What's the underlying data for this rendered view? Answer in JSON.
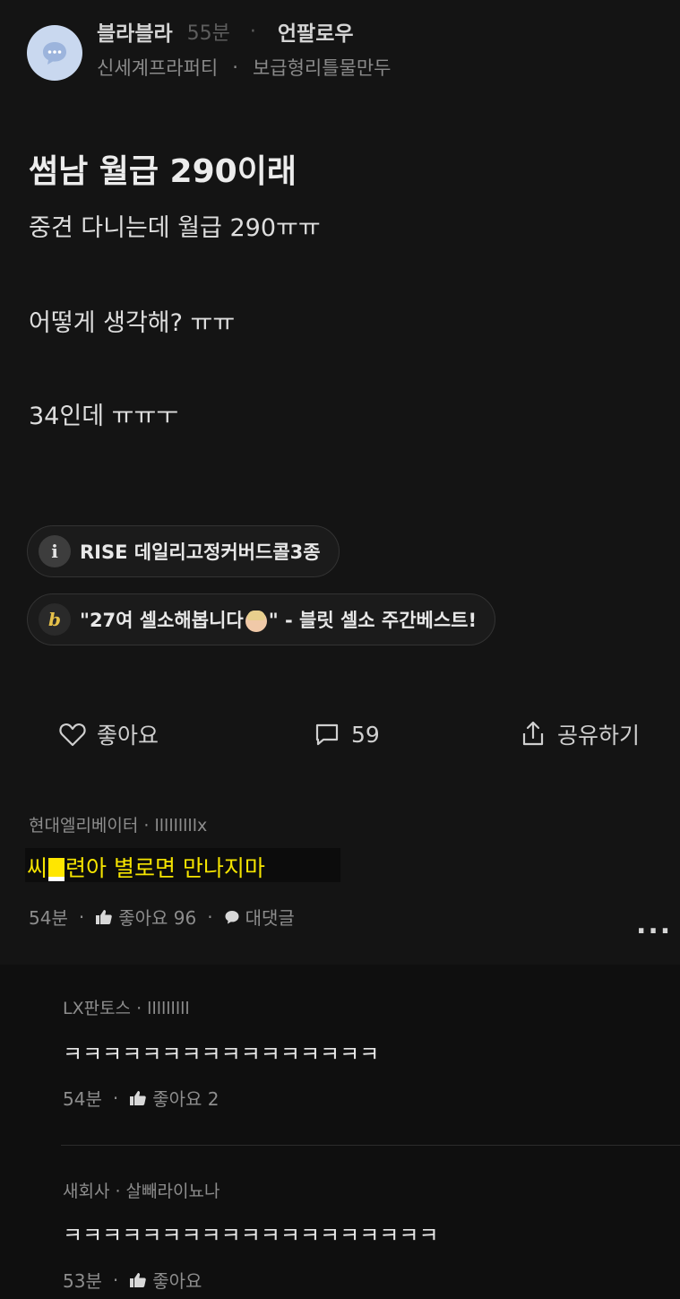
{
  "header": {
    "author": "블라블라",
    "time": "55분",
    "dot": "·",
    "follow_label": "언팔로우",
    "company": "신세계프라퍼티",
    "separator": "·",
    "nickname": "보급형리틀물만두"
  },
  "post": {
    "title": "썸남 월급 290이래",
    "lines": [
      "중견 다니는데 월급 290ㅠㅠ",
      "어떻게 생각해? ㅠㅠ",
      "34인데 ㅠㅠㅜ"
    ]
  },
  "chips": [
    {
      "icon": "i",
      "text": "RISE 데일리고정커버드콜3종"
    },
    {
      "icon": "b",
      "text_before": "\"27여 셀소해봅니다",
      "text_after": "\" - 블릿 셀소 주간베스트!"
    }
  ],
  "actions": {
    "like_label": "좋아요",
    "comment_count": "59",
    "share_label": "공유하기"
  },
  "comments": [
    {
      "meta": "현대엘리베이터 · lllllllllx",
      "text_before": "씨",
      "text_after": "련아 별로면 만나지마",
      "time": "54분",
      "dot": "·",
      "likes": "좋아요 96",
      "reply_label": "대댓글",
      "more": "..."
    }
  ],
  "replies": [
    {
      "meta": "LX판토스 · lllllllll",
      "text": "ㅋㅋㅋㅋㅋㅋㅋㅋㅋㅋㅋㅋㅋㅋㅋㅋ",
      "time": "54분",
      "dot": "·",
      "likes": "좋아요 2"
    },
    {
      "meta": "새회사 · 살빼라이뇨나",
      "text": "ㅋㅋㅋㅋㅋㅋㅋㅋㅋㅋㅋㅋㅋㅋㅋㅋㅋㅋㅋ",
      "time": "53분",
      "dot": "·",
      "likes": "좋아요"
    }
  ],
  "colors": {
    "background": "#141414",
    "highlight_text": "#f5e400",
    "avatar": "#c9d8ef"
  }
}
